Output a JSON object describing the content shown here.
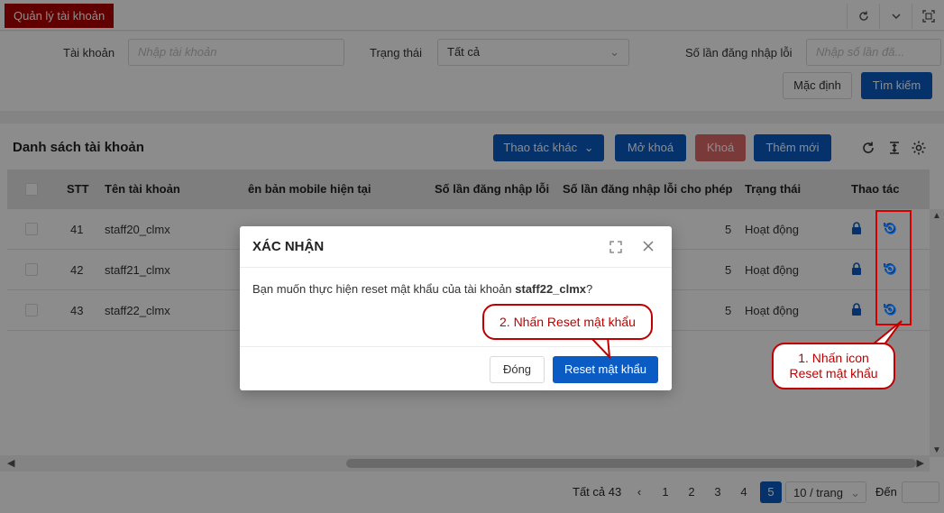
{
  "app": {
    "tab_label": "Quản lý tài khoản"
  },
  "filter": {
    "account_label": "Tài khoản",
    "account_placeholder": "Nhập tài khoản",
    "status_label": "Trạng thái",
    "status_value": "Tất cả",
    "fail_count_label": "Số lần đăng nhập lỗi",
    "fail_count_placeholder": "Nhập số lần đă...",
    "default_button": "Mặc định",
    "search_button": "Tìm kiếm"
  },
  "list": {
    "title": "Danh sách tài khoản",
    "other_actions_button": "Thao tác khác",
    "unlock_button": "Mở khoá",
    "lock_button": "Khoá",
    "add_button": "Thêm mới",
    "columns": {
      "stt": "STT",
      "account": "Tên tài khoản",
      "mobile": "ên bản mobile hiện tại",
      "fail_count": "Số lần đăng nhập lỗi",
      "fail_allowed": "Số lần đăng nhập lỗi cho phép",
      "status": "Trạng thái",
      "actions": "Thao tác"
    },
    "rows": [
      {
        "stt": "41",
        "account": "staff20_clmx",
        "fail_allowed": "5",
        "status": "Hoạt động"
      },
      {
        "stt": "42",
        "account": "staff21_clmx",
        "fail_allowed": "5",
        "status": "Hoạt động"
      },
      {
        "stt": "43",
        "account": "staff22_clmx",
        "fail_allowed": "5",
        "status": "Hoạt động"
      }
    ]
  },
  "pagination": {
    "total": "Tất cả 43",
    "pages": [
      "1",
      "2",
      "3",
      "4",
      "5"
    ],
    "active_page": "5",
    "page_size": "10 / trang",
    "goto_label": "Đến"
  },
  "modal": {
    "title": "XÁC NHẬN",
    "message_prefix": "Bạn muốn thực hiện reset mật khẩu của tài khoản ",
    "message_account": "staff22_clmx",
    "message_suffix": "?",
    "close_button": "Đóng",
    "reset_button": "Reset mật khẩu"
  },
  "annotations": {
    "step1_line1": "1. Nhấn icon",
    "step1_line2": "Reset mật khẩu",
    "step2": "2. Nhấn Reset mật khẩu"
  },
  "colors": {
    "brand_red": "#b00000",
    "primary_blue": "#0a5bc4",
    "lock_red": "#e06b6b",
    "annotation_red": "#c00000"
  }
}
